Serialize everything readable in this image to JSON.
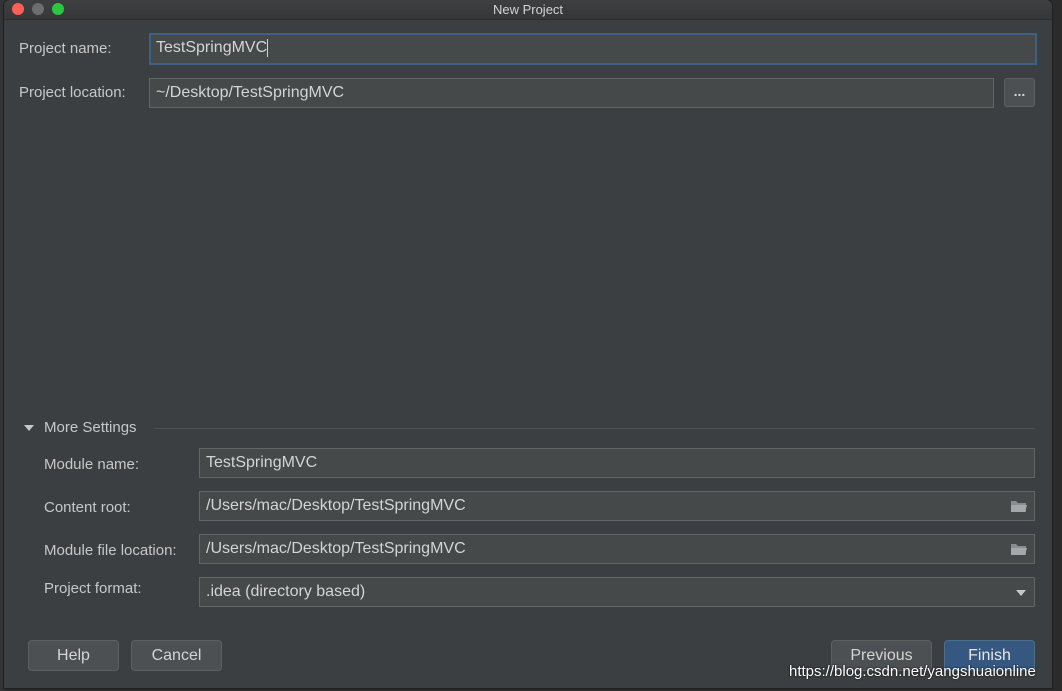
{
  "window": {
    "title": "New Project"
  },
  "project": {
    "name_label": "Project name:",
    "name_value": "TestSpringMVC",
    "location_label": "Project location:",
    "location_value": "~/Desktop/TestSpringMVC",
    "browse_label": "..."
  },
  "more_settings": {
    "heading": "More Settings",
    "module_name_label": "Module name:",
    "module_name_value": "TestSpringMVC",
    "content_root_label": "Content root:",
    "content_root_value": "/Users/mac/Desktop/TestSpringMVC",
    "module_file_label": "Module file location:",
    "module_file_value": "/Users/mac/Desktop/TestSpringMVC",
    "format_label": "Project format:",
    "format_value": ".idea (directory based)"
  },
  "buttons": {
    "help": "Help",
    "cancel": "Cancel",
    "previous": "Previous",
    "finish": "Finish"
  },
  "watermark": "https://blog.csdn.net/yangshuaionline",
  "colors": {
    "background": "#3c3f41",
    "field": "#45494a",
    "focus_border": "#3d6185",
    "primary_button": "#365880"
  },
  "icons": [
    "close-icon",
    "minimize-icon",
    "maximize-icon",
    "folder-icon",
    "chevron-down-icon",
    "triangle-down-icon"
  ]
}
